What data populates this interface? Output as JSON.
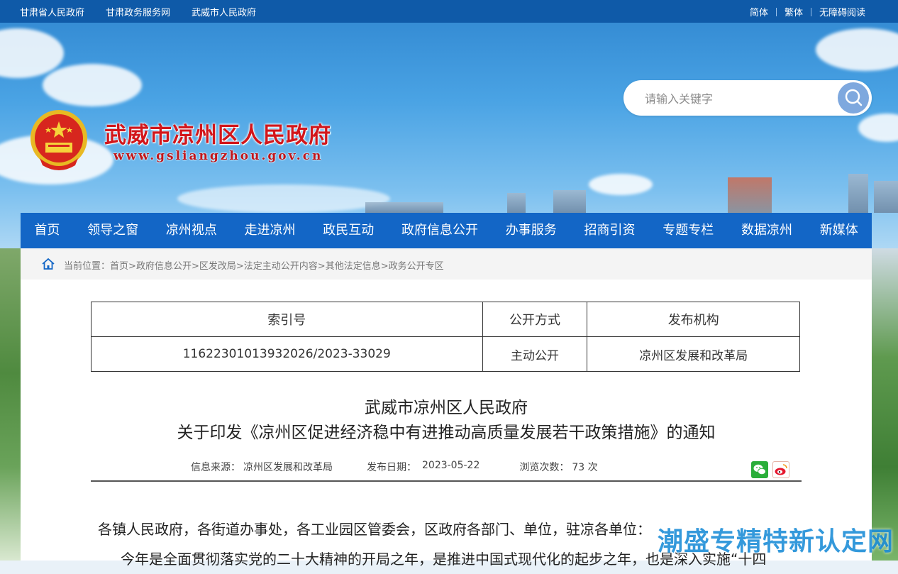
{
  "topbar": {
    "left_links": [
      "甘肃省人民政府",
      "甘肃政务服务网",
      "武威市人民政府"
    ],
    "right_links": [
      "简体",
      "繁体",
      "无障碍阅读"
    ]
  },
  "header": {
    "title": "武威市凉州区人民政府",
    "url": "www.gsliangzhou.gov.cn",
    "search_placeholder": "请输入关键字"
  },
  "nav": [
    "首页",
    "领导之窗",
    "凉州视点",
    "走进凉州",
    "政民互动",
    "政府信息公开",
    "办事服务",
    "招商引资",
    "专题专栏",
    "数据凉州",
    "新媒体"
  ],
  "breadcrumb": {
    "prefix": "当前位置：",
    "items": [
      "首页",
      "政府信息公开",
      "区发改局",
      "法定主动公开内容",
      "其他法定信息",
      "政务公开专区"
    ],
    "separator": ">"
  },
  "meta_table": {
    "headers": [
      "索引号",
      "公开方式",
      "发布机构"
    ],
    "values": [
      "11622301013932026/2023-33029",
      "主动公开",
      "凉州区发展和改革局"
    ]
  },
  "document": {
    "title_line1": "武威市凉州区人民政府",
    "title_line2": "关于印发《凉州区促进经济稳中有进推动高质量发展若干政策措施》的通知",
    "source_label": "信息来源：",
    "source": "凉州区发展和改革局",
    "date_label": "发布日期：",
    "date": "2023-05-22",
    "views_label": "浏览次数：",
    "views": "73 次",
    "salutation": "各镇人民政府，各街道办事处，各工业园区管委会，区政府各部门、单位，驻凉各单位：",
    "paragraph1": "今年是全面贯彻落实党的二十大精神的开局之年，是推进中国式现代化的起步之年，也是深入实施“十四"
  },
  "share_icons": [
    "wechat-icon",
    "weibo-icon"
  ],
  "watermark": "潮盛专精特新认定网",
  "colors": {
    "topbar": "#0f5aa8",
    "nav": "#1366c6",
    "title_red": "#d2161b",
    "watermark": "#1f8ed8"
  }
}
